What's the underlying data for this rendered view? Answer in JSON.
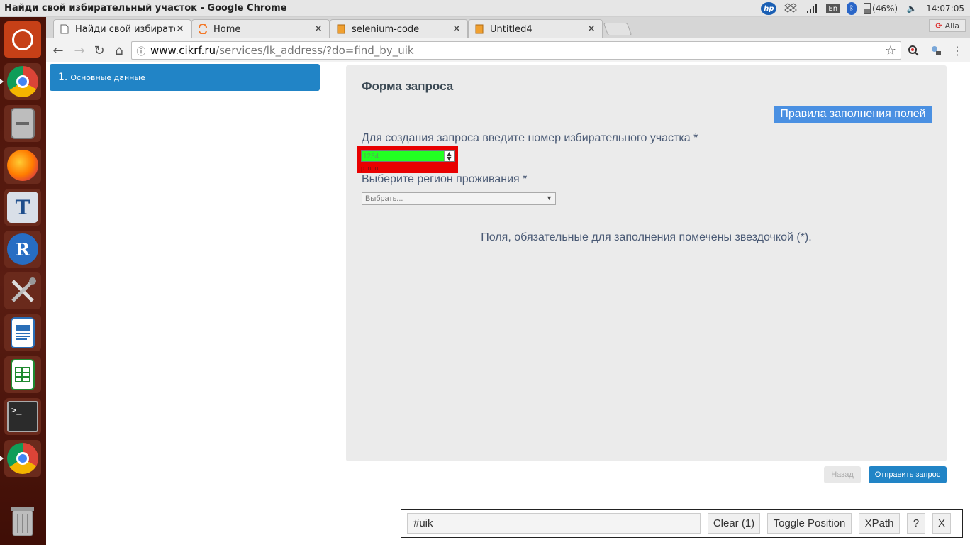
{
  "os": {
    "window_title": "Найди свой избирательный участок - Google Chrome",
    "battery": "(46%)",
    "clock": "14:07:05",
    "keyboard_layout": "En",
    "hp_label": "hp"
  },
  "launcher": {
    "items": [
      {
        "name": "ubuntu-dash-icon",
        "color": "#dd4814"
      },
      {
        "name": "chrome-icon",
        "color": "#4285f4"
      },
      {
        "name": "files-icon",
        "color": "#8a8a8a"
      },
      {
        "name": "firefox-icon",
        "color": "#ff7b00"
      },
      {
        "name": "texstudio-icon",
        "color": "#3b6ea8"
      },
      {
        "name": "r-icon",
        "color": "#276dc3"
      },
      {
        "name": "system-tools-icon",
        "color": "#777777"
      },
      {
        "name": "writer-icon",
        "color": "#2a6fb8"
      },
      {
        "name": "calc-icon",
        "color": "#1e8a2f"
      },
      {
        "name": "terminal-icon",
        "color": "#333333"
      },
      {
        "name": "chrome-icon-2",
        "color": "#4285f4"
      },
      {
        "name": "trash-icon",
        "color": "#9a9a9a"
      }
    ],
    "glyphs": {
      "r": "R",
      "texstudio": "T"
    }
  },
  "browser": {
    "tabs": [
      {
        "label": "Найди свой избирате",
        "active": true
      },
      {
        "label": "Home",
        "active": false
      },
      {
        "label": "selenium-code",
        "active": false
      },
      {
        "label": "Untitled4",
        "active": false
      }
    ],
    "user": "Alla",
    "url_host": "www.cikrf.ru",
    "url_path": "/services/lk_address/?do=find_by_uik"
  },
  "page": {
    "step": {
      "number": "1.",
      "label": "Основные данные"
    },
    "form_title": "Форма запроса",
    "rules_button": "Правила заполнения полей",
    "uik_label": "Для создания запроса введите номер избирательного участка *",
    "uik_value": "1234",
    "uik_tag": "p input",
    "region_label": "Выберите регион проживания *",
    "region_value": "Выбрать...",
    "required_note": "Поля, обязательные для заполнения помечены звездочкой (*).",
    "back_button": "Назад",
    "submit_button": "Отправить запрос"
  },
  "helper": {
    "selector": "#uik",
    "clear": "Clear (1)",
    "toggle": "Toggle Position",
    "xpath": "XPath",
    "help": "?",
    "close": "X"
  }
}
